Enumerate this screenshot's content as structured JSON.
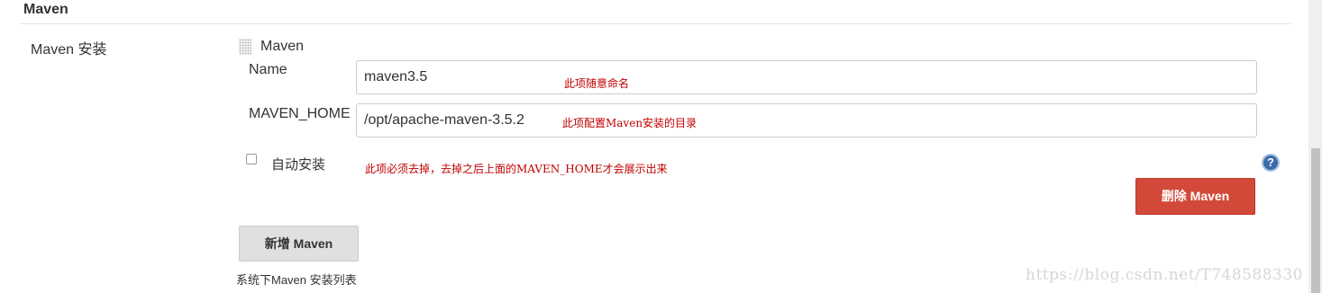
{
  "section": {
    "title": "Maven",
    "row_label": "Maven 安装"
  },
  "installation": {
    "header": "Maven",
    "name_label": "Name",
    "name_value": "maven3.5",
    "home_label": "MAVEN_HOME",
    "home_value": "/opt/apache-maven-3.5.2",
    "auto_install_label": "自动安装",
    "auto_install_checked": false,
    "help_icon": "question-circle-icon",
    "delete_button_label": "删除 Maven"
  },
  "annotations": {
    "name_note": "此项随意命名",
    "home_note": "此项配置Maven安装的目录",
    "auto_install_note": "此项必须去掉，去掉之后上面的MAVEN_HOME才会展示出来"
  },
  "footer": {
    "add_button_label": "新增 Maven",
    "list_caption": "系统下Maven 安装列表"
  },
  "watermark": "https://blog.csdn.net/T748588330",
  "colors": {
    "delete_button": "#d24939",
    "annotation_text": "#c00000",
    "help_icon": "#3a6aa8"
  }
}
